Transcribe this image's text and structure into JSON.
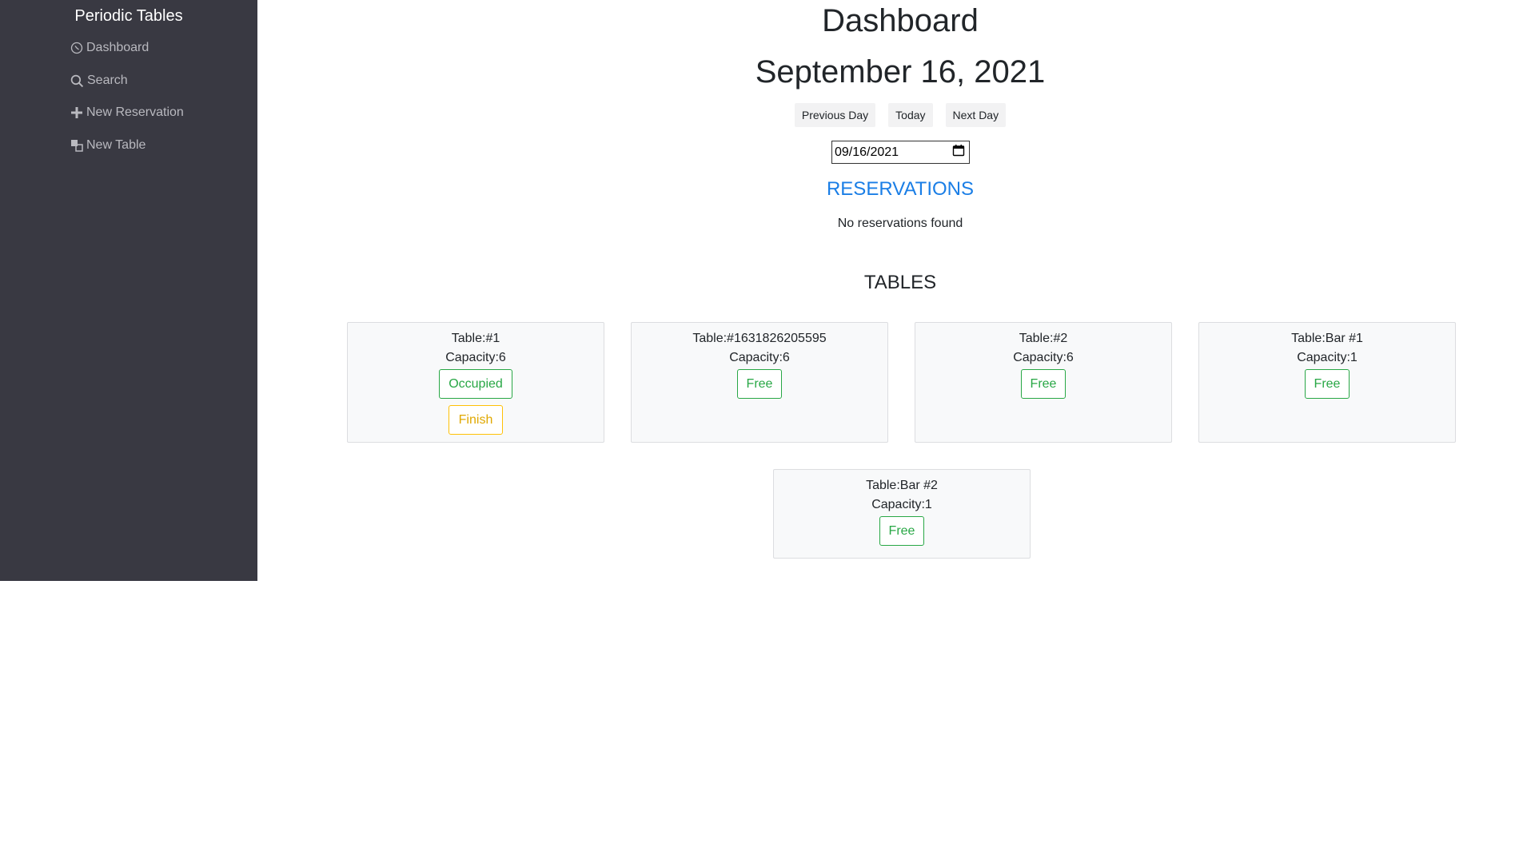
{
  "sidebar": {
    "brand": "Periodic Tables",
    "items": [
      {
        "label": "Dashboard",
        "icon": "dashboard-icon"
      },
      {
        "label": "Search",
        "icon": "search-icon"
      },
      {
        "label": "New Reservation",
        "icon": "plus-icon"
      },
      {
        "label": "New Table",
        "icon": "layers-icon"
      }
    ]
  },
  "main": {
    "title": "Dashboard",
    "date_title": "September 16, 2021",
    "buttons": {
      "previous": "Previous Day",
      "today": "Today",
      "next": "Next Day"
    },
    "date_input": "09/16/2021",
    "reservations_heading": "RESERVATIONS",
    "no_reservations": "No reservations found",
    "tables_heading": "TABLES",
    "tables": [
      {
        "name": "Table:#1",
        "capacity": "Capacity:6",
        "status": "Occupied",
        "finish": "Finish"
      },
      {
        "name": "Table:#1631826205595",
        "capacity": "Capacity:6",
        "status": "Free"
      },
      {
        "name": "Table:#2",
        "capacity": "Capacity:6",
        "status": "Free"
      },
      {
        "name": "Table:Bar #1",
        "capacity": "Capacity:1",
        "status": "Free"
      },
      {
        "name": "Table:Bar #2",
        "capacity": "Capacity:1",
        "status": "Free"
      }
    ]
  },
  "colors": {
    "sidebar_bg": "#393942",
    "accent_blue": "#1a7ee6",
    "free_green": "#28a745",
    "finish_yellow": "#ffc107"
  }
}
